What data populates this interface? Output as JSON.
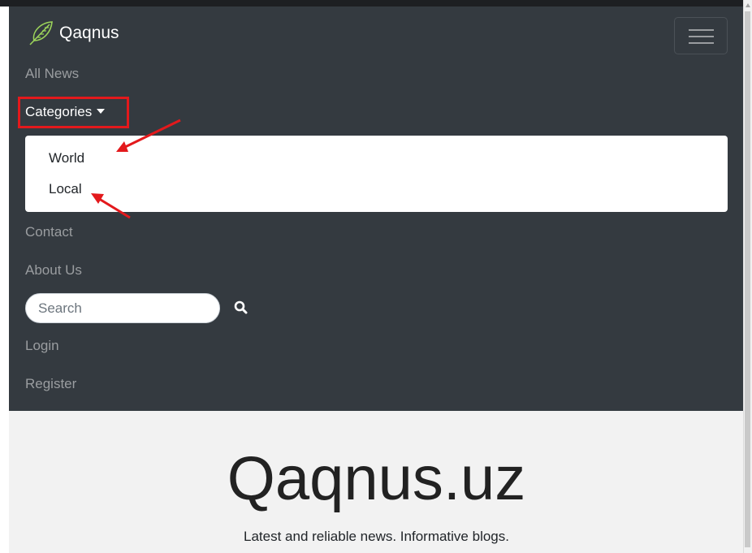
{
  "brand": {
    "name": "Qaqnus",
    "logo_icon": "feather-icon"
  },
  "nav": {
    "all_news": "All News",
    "categories": "Categories",
    "dropdown_items": [
      "World",
      "Local"
    ],
    "contact": "Contact",
    "about": "About Us",
    "login": "Login",
    "register": "Register"
  },
  "search": {
    "placeholder": "Search",
    "icon": "search-icon"
  },
  "hero": {
    "title": "Qaqnus.uz",
    "lead": "Latest and reliable news. Informative blogs."
  },
  "colors": {
    "navbar_bg": "#343a40",
    "nav_link": "#9a9da0",
    "highlight_box": "#e3191c",
    "annotation_arrow": "#e3191c",
    "hero_bg": "#f2f2f2"
  }
}
